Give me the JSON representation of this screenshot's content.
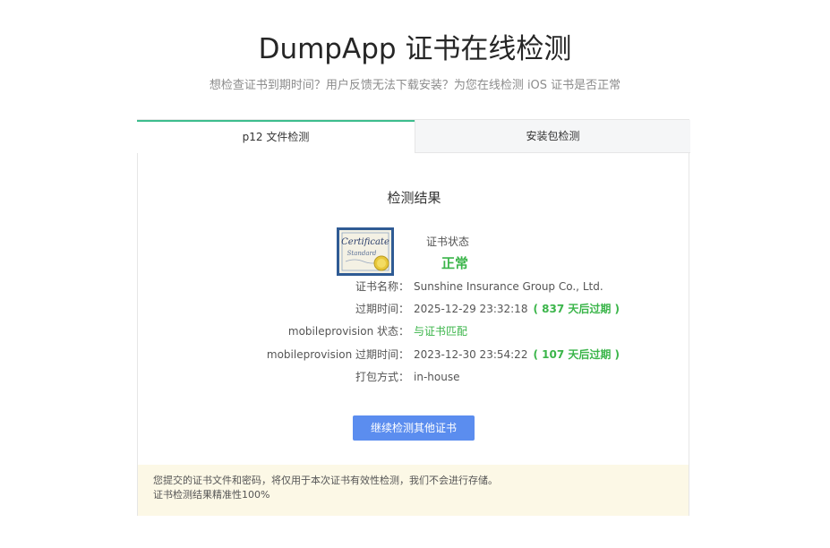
{
  "header": {
    "title": "DumpApp 证书在线检测",
    "subtitle": "想检查证书到期时间？用户反馈无法下载安装？为您在线检测 iOS 证书是否正常"
  },
  "tabs": [
    {
      "label": "p12 文件检测",
      "active": true
    },
    {
      "label": "安装包检测",
      "active": false
    }
  ],
  "result": {
    "title": "检测结果",
    "certificate_image": {
      "line1": "Certificate",
      "line2": "Standard"
    },
    "status_label": "证书状态",
    "status_value": "正常",
    "rows": [
      {
        "label": "证书名称：",
        "value": "Sunshine Insurance Group Co., Ltd."
      },
      {
        "label": "过期时间：",
        "value": "2025-12-29 23:32:18",
        "note": "( 837 天后过期 )"
      },
      {
        "label": "mobileprovision 状态：",
        "value": "与证书匹配"
      },
      {
        "label": "mobileprovision 过期时间：",
        "value": "2023-12-30 23:54:22",
        "note": "( 107 天后过期 )"
      },
      {
        "label": "打包方式：",
        "value": "in-house"
      }
    ],
    "button_label": "继续检测其他证书"
  },
  "notice": {
    "line1": "您提交的证书文件和密码，将仅用于本次证书有效性检测，我们不会进行存储。",
    "line2": "证书检测结果精准性100%"
  },
  "colors": {
    "accent": "#3dbd8e",
    "status_ok": "#3bb54a",
    "button": "#5b8def",
    "notice_bg": "#fcf8e6"
  }
}
